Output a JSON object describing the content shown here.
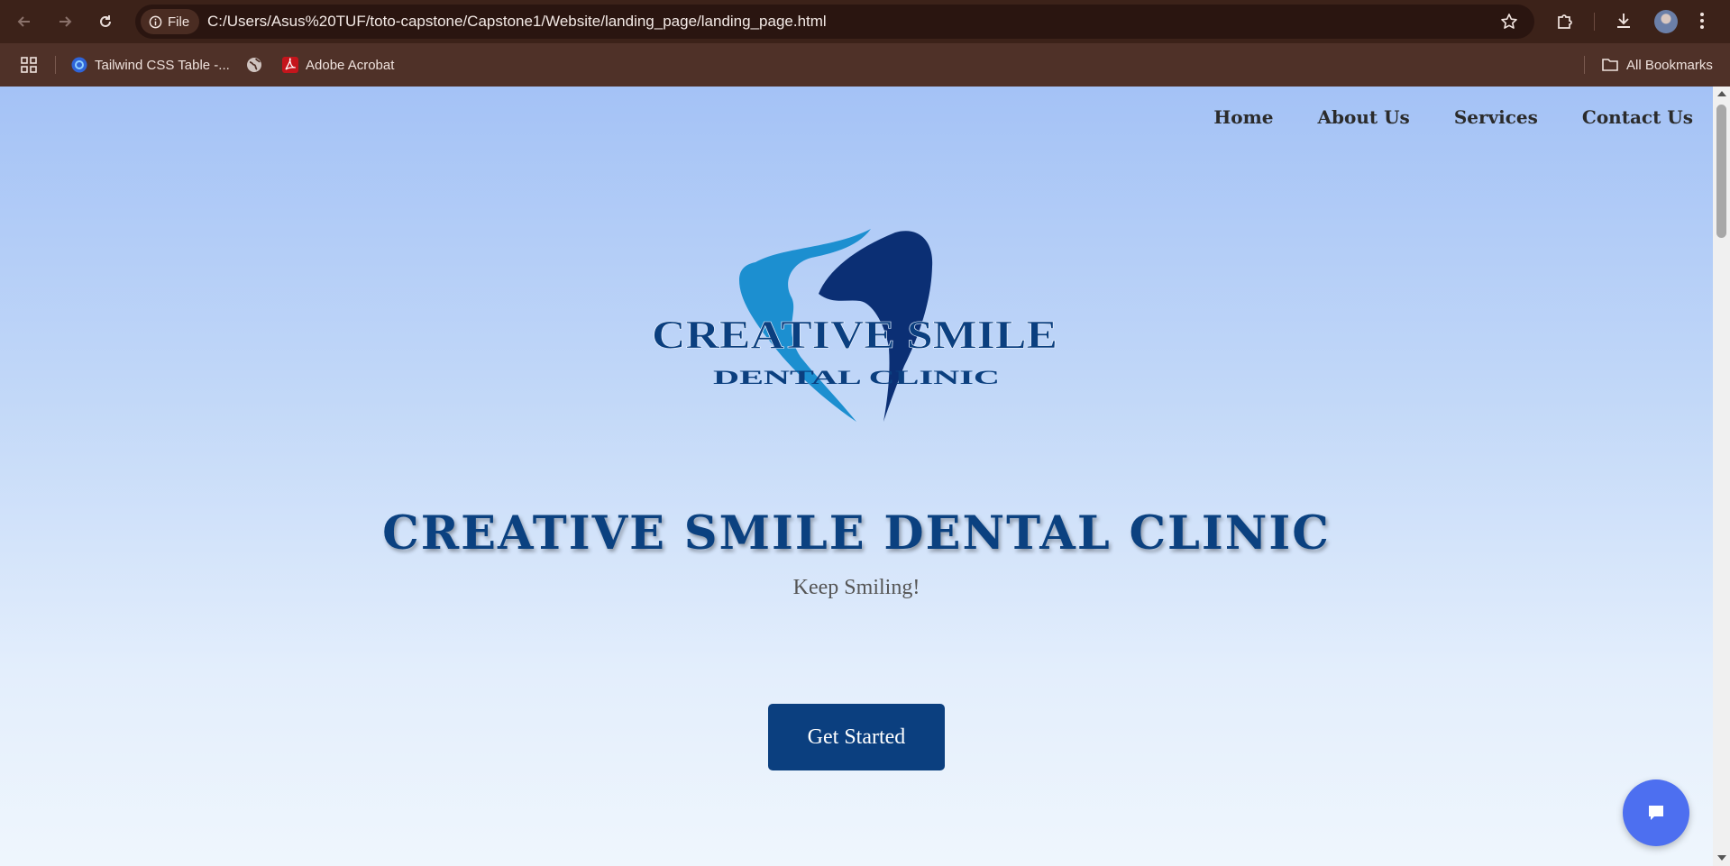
{
  "browser": {
    "file_label": "File",
    "url": "C:/Users/Asus%20TUF/toto-capstone/Capstone1/Website/landing_page/landing_page.html",
    "bookmarks": [
      {
        "label": "Tailwind CSS Table -...",
        "icon": "tailwind-favicon"
      },
      {
        "label": "",
        "icon": "globe-icon"
      },
      {
        "label": "Adobe Acrobat",
        "icon": "acrobat-icon"
      }
    ],
    "all_bookmarks_label": "All Bookmarks"
  },
  "site": {
    "nav": [
      {
        "label": "Home"
      },
      {
        "label": "About Us"
      },
      {
        "label": "Services"
      },
      {
        "label": "Contact Us"
      }
    ],
    "logo": {
      "line1": "CREATIVE SMILE",
      "line2": "DENTAL CLINIC"
    },
    "hero": {
      "title": "CREATIVE SMILE DENTAL CLINIC",
      "tagline": "Keep Smiling!",
      "cta_label": "Get Started"
    },
    "chat_icon": "chat-bubble-icon"
  },
  "colors": {
    "brand_dark": "#0b3f7f",
    "brand_light": "#1c8fd0",
    "chat_button": "#4d6ff0"
  }
}
